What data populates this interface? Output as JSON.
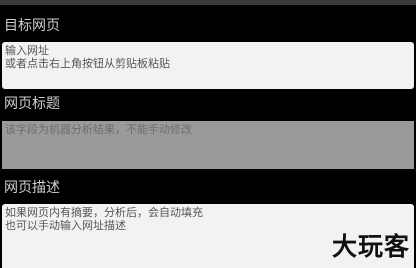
{
  "form": {
    "url_section": {
      "label": "目标网页",
      "placeholder_line1": "输入网址",
      "placeholder_line2": "或者点击右上角按钮从剪贴板粘贴"
    },
    "title_section": {
      "label": "网页标题",
      "placeholder": "该字段为机器分析结果，不能手动修改"
    },
    "description_section": {
      "label": "网页描述",
      "placeholder_line1": "如果网页内有摘要，分析后，会自动填充",
      "placeholder_line2": "也可以手动输入网址描述"
    }
  },
  "watermark": "大玩客",
  "colors": {
    "background": "#000000",
    "label_text": "#cfcfcf",
    "input_bg": "#f2f2f2",
    "disabled_bg": "#9a9a9a"
  }
}
